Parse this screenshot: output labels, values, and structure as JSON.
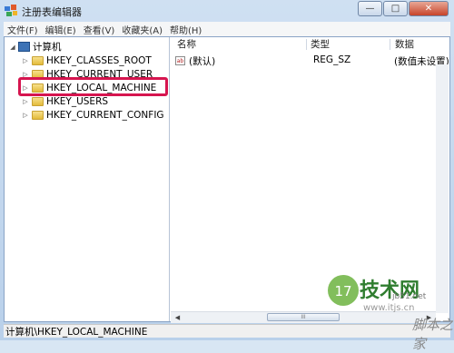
{
  "window": {
    "title": "注册表编辑器",
    "controls": {
      "minimize": "—",
      "maximize": "□",
      "close": "✕"
    }
  },
  "menu": [
    "文件(F)",
    "编辑(E)",
    "查看(V)",
    "收藏夹(A)",
    "帮助(H)"
  ],
  "tree": {
    "root": {
      "label": "计算机",
      "expander": "◢"
    },
    "items": [
      {
        "label": "HKEY_CLASSES_ROOT",
        "expander": "▷"
      },
      {
        "label": "HKEY_CURRENT_USER",
        "expander": "▷"
      },
      {
        "label": "HKEY_LOCAL_MACHINE",
        "expander": "▷"
      },
      {
        "label": "HKEY_USERS",
        "expander": "▷"
      },
      {
        "label": "HKEY_CURRENT_CONFIG",
        "expander": "▷"
      }
    ]
  },
  "list": {
    "columns": [
      "名称",
      "类型",
      "数据"
    ],
    "rows": [
      {
        "name": "(默认)",
        "type": "REG_SZ",
        "data": "(数值未设置)",
        "icon": "ab"
      }
    ]
  },
  "scrollbar": {
    "left_arrow": "◀",
    "right_arrow": "▶",
    "thumb": "III"
  },
  "statusbar": {
    "path": "计算机\\HKEY_LOCAL_MACHINE"
  },
  "watermark": {
    "brand": "技术网",
    "logo": "17",
    "url": "www.itjs.cn",
    "site": "jb51.net",
    "corner": "脚本之家"
  },
  "colors": {
    "highlight_border": "#d6154f",
    "folder": "#e3bb3b",
    "watermark_green": "#2f7d2f"
  }
}
